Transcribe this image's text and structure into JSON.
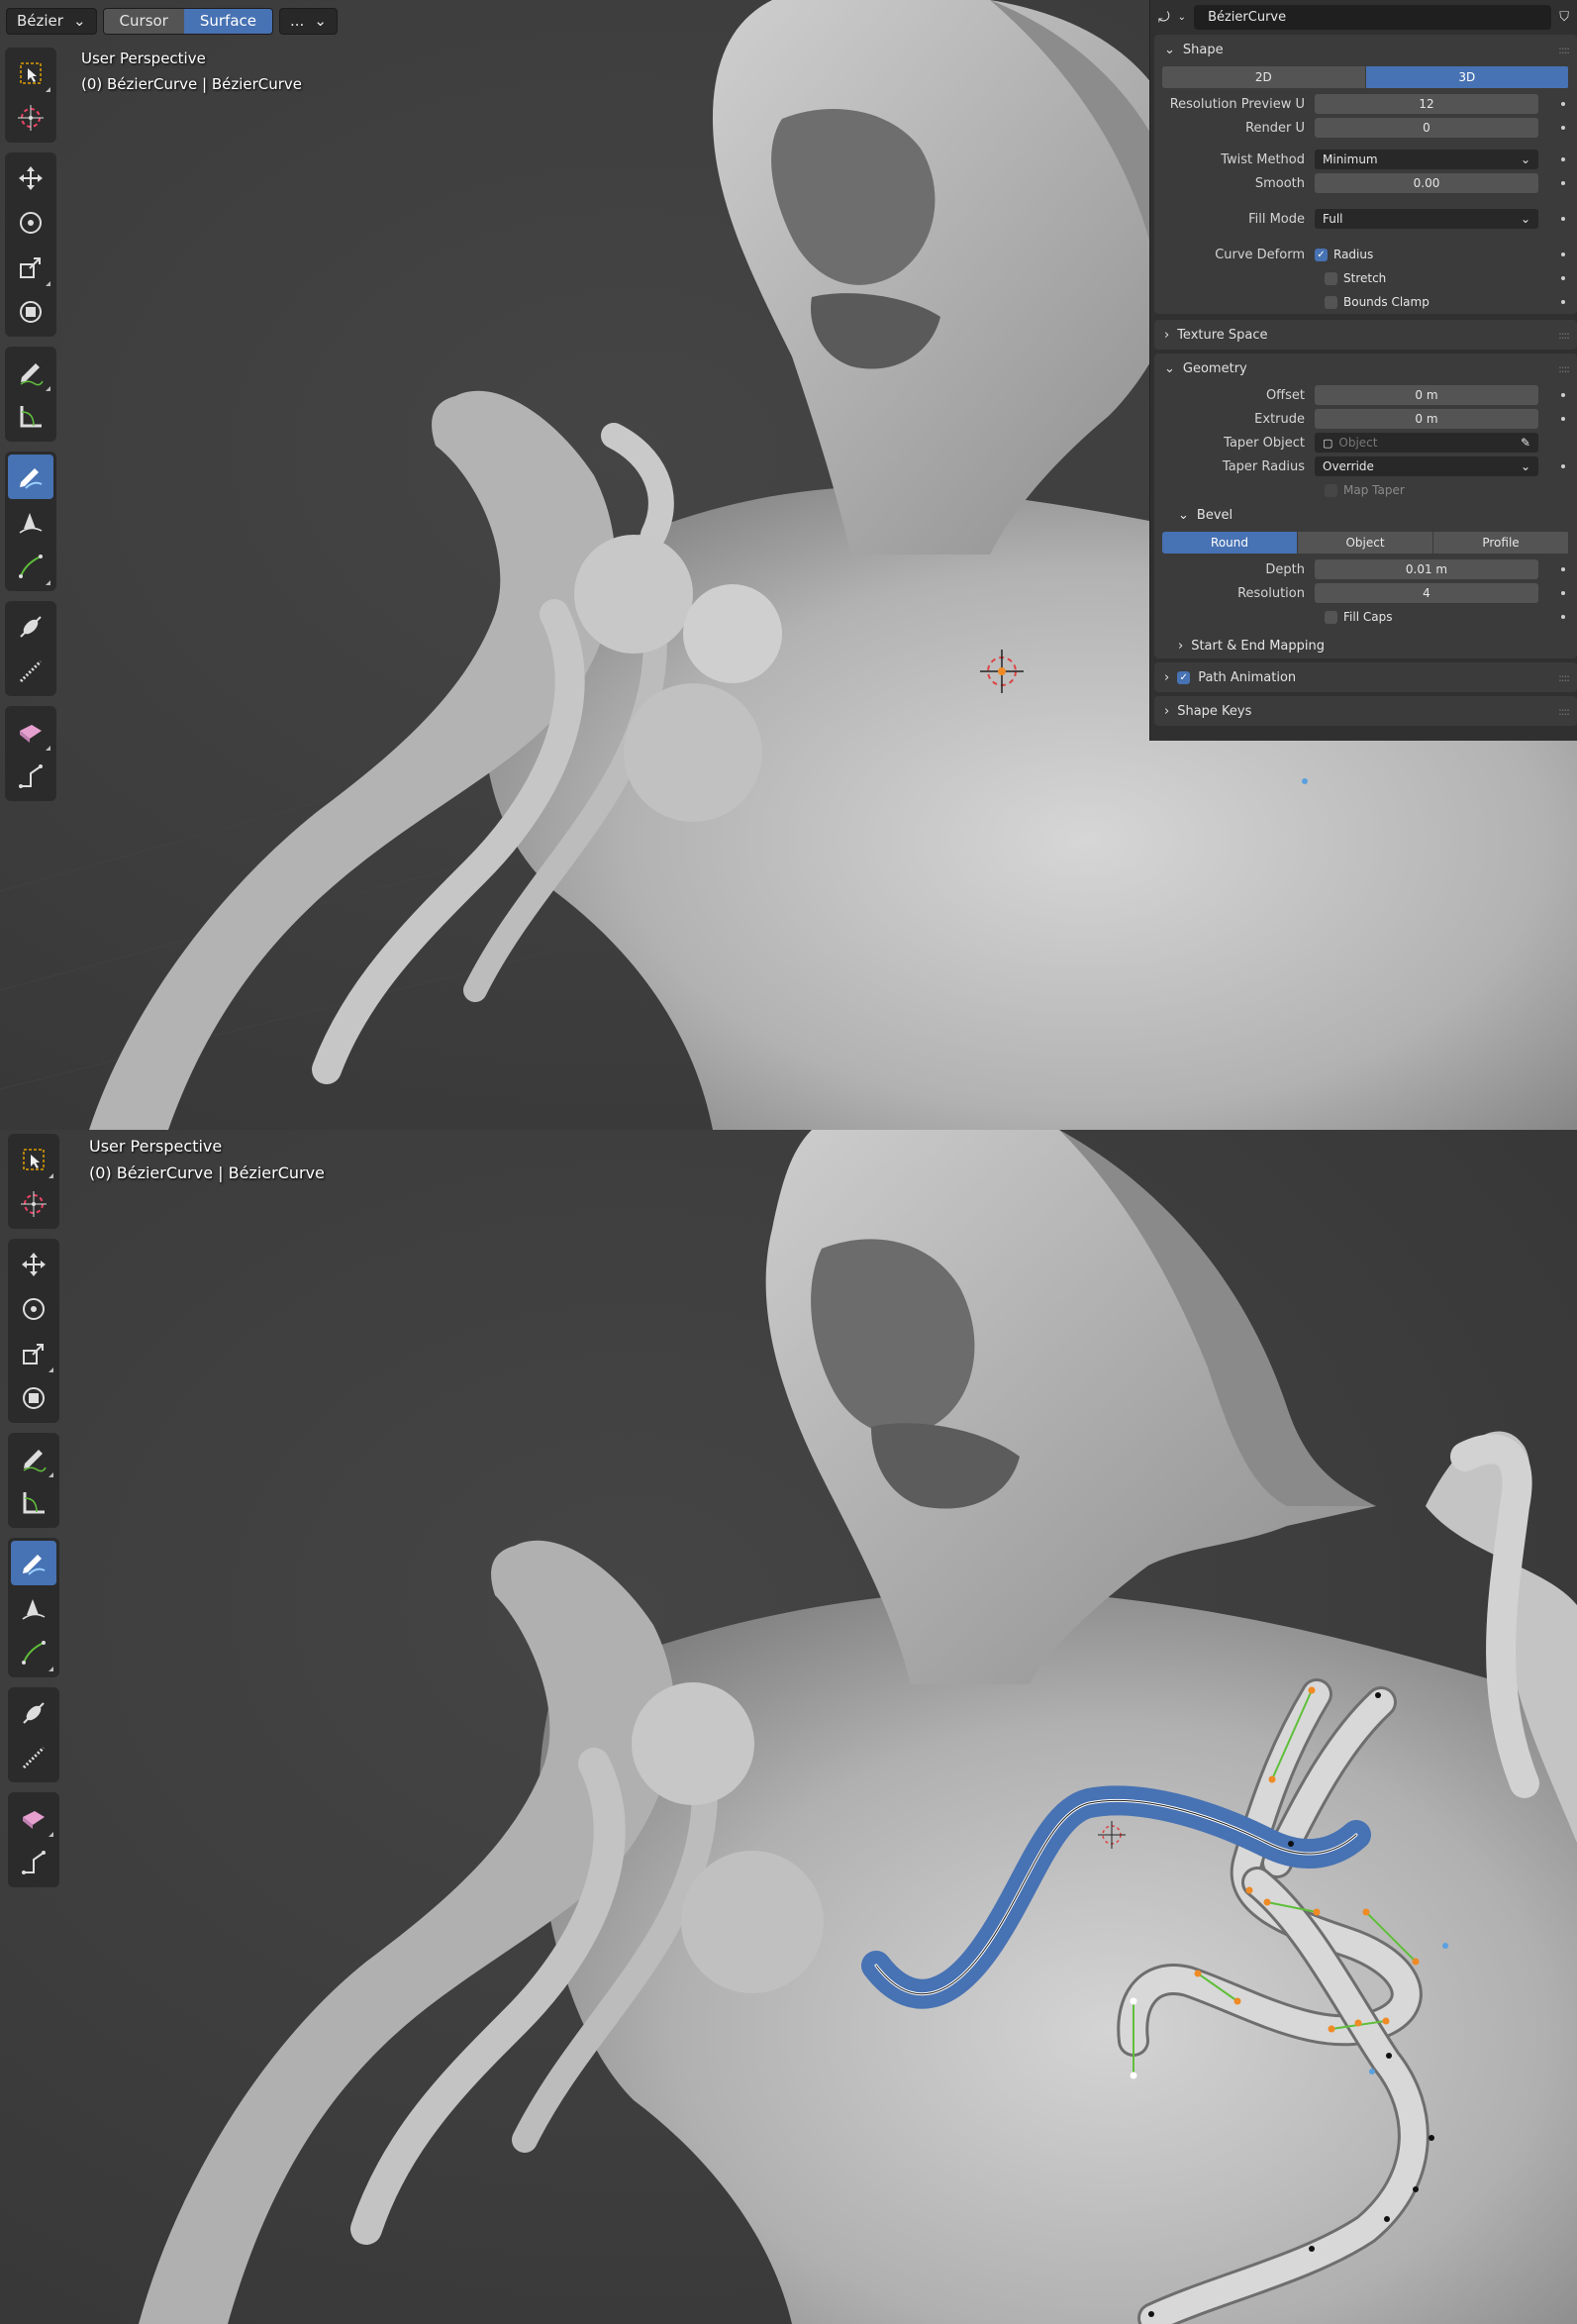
{
  "header": {
    "curve_type": "Bézier",
    "snap_cursor": "Cursor",
    "snap_surface": "Surface",
    "more": "..."
  },
  "viewport_top": {
    "perspective": "User Perspective",
    "object_info": "(0) BézierCurve | BézierCurve"
  },
  "viewport_bottom": {
    "perspective": "User Perspective",
    "object_info": "(0) BézierCurve | BézierCurve"
  },
  "properties": {
    "object_name": "BézierCurve",
    "shape": {
      "title": "Shape",
      "dim_2d": "2D",
      "dim_3d": "3D",
      "resolution_preview_u_label": "Resolution Preview U",
      "resolution_preview_u": "12",
      "render_u_label": "Render U",
      "render_u": "0",
      "twist_method_label": "Twist Method",
      "twist_method": "Minimum",
      "smooth_label": "Smooth",
      "smooth": "0.00",
      "fill_mode_label": "Fill Mode",
      "fill_mode": "Full",
      "curve_deform_label": "Curve Deform",
      "radius": "Radius",
      "stretch": "Stretch",
      "bounds_clamp": "Bounds Clamp"
    },
    "texture_space": "Texture Space",
    "geometry": {
      "title": "Geometry",
      "offset_label": "Offset",
      "offset": "0 m",
      "extrude_label": "Extrude",
      "extrude": "0 m",
      "taper_object_label": "Taper Object",
      "taper_object_placeholder": "Object",
      "taper_radius_label": "Taper Radius",
      "taper_radius": "Override",
      "map_taper": "Map Taper"
    },
    "bevel": {
      "title": "Bevel",
      "mode_round": "Round",
      "mode_object": "Object",
      "mode_profile": "Profile",
      "depth_label": "Depth",
      "depth": "0.01 m",
      "resolution_label": "Resolution",
      "resolution": "4",
      "fill_caps": "Fill Caps"
    },
    "start_end_mapping": "Start & End Mapping",
    "path_animation": "Path Animation",
    "shape_keys": "Shape Keys"
  },
  "colors": {
    "accent": "#4772b3",
    "mesh": "#b9b9b9",
    "handle_green": "#5fbf3a",
    "handle_orange": "#f08a24"
  }
}
